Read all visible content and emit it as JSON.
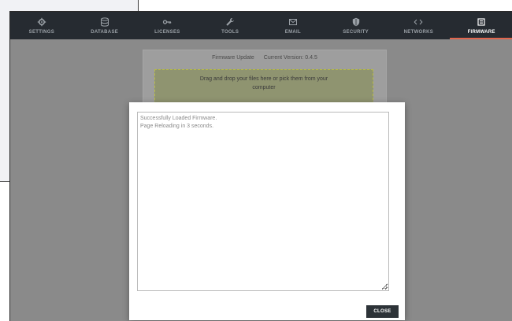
{
  "nav": {
    "items": [
      {
        "label": "SETTINGS",
        "icon": "gear-icon"
      },
      {
        "label": "DATABASE",
        "icon": "database-icon"
      },
      {
        "label": "LICENSES",
        "icon": "key-icon"
      },
      {
        "label": "TOOLS",
        "icon": "wrench-icon"
      },
      {
        "label": "EMAIL",
        "icon": "mail-icon"
      },
      {
        "label": "SECURITY",
        "icon": "shield-icon"
      },
      {
        "label": "NETWORKS",
        "icon": "code-icon"
      },
      {
        "label": "FIRMWARE",
        "icon": "chip-icon"
      }
    ],
    "active": "FIRMWARE",
    "active_color": "#e0664e"
  },
  "firmware": {
    "title": "Firmware Update",
    "version_label": "Current Version: 0.4.5",
    "dropzone_line1": "Drag and drop your files here or pick them from your",
    "dropzone_line2": "computer"
  },
  "modal": {
    "log_line1": "Successfully Loaded Firmware.",
    "log_line2": "Page Reloading in 3 seconds.",
    "close_label": "CLOSE"
  }
}
